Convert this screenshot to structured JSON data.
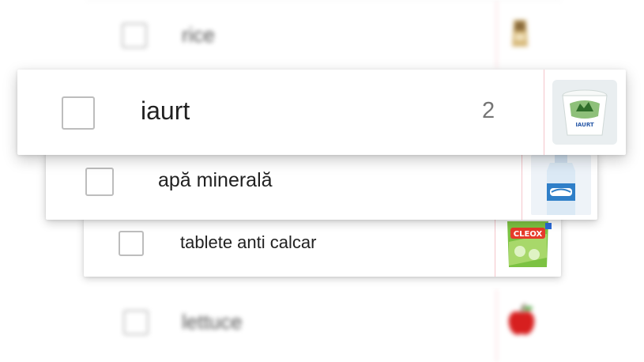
{
  "list": {
    "items": [
      {
        "label": "rice",
        "quantity": "",
        "thumbnail": "rice-bag-icon"
      },
      {
        "label": "iaurt",
        "quantity": "2",
        "thumbnail": "yogurt-tub-icon"
      },
      {
        "label": "apă minerală",
        "quantity": "",
        "thumbnail": "water-bottle-icon"
      },
      {
        "label": "tablete anti calcar",
        "quantity": "",
        "thumbnail": "cleox-package-icon"
      },
      {
        "label": "lettuce",
        "quantity": "",
        "thumbnail": "apple-icon"
      }
    ],
    "product_text": {
      "yogurt": "IAURT",
      "cleox": "CLEOX"
    }
  },
  "colors": {
    "divider": "#f5c6cb",
    "checkbox_border": "#bdbdbd",
    "text": "#212121",
    "quantity_text": "#757575"
  }
}
